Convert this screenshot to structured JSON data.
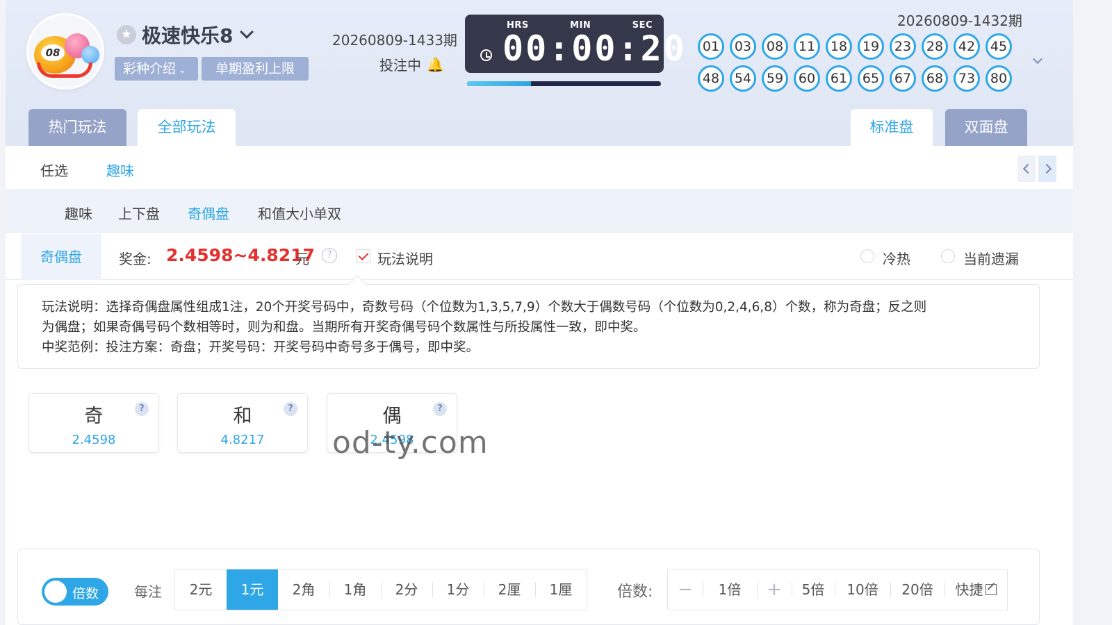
{
  "header": {
    "game_name": "极速快乐8",
    "logo_ball_number": "08",
    "tags": [
      "彩种介绍",
      "单期盈利上限"
    ],
    "current_issue": "20260809-1433期",
    "status": "投注中",
    "timer": {
      "labels": [
        "HRS",
        "MIN",
        "SEC"
      ],
      "display": "00:00:20",
      "progress": 0.33
    },
    "last_issue": "20260809-1432期",
    "draw_numbers": [
      "01",
      "03",
      "08",
      "11",
      "18",
      "19",
      "23",
      "28",
      "42",
      "45",
      "48",
      "54",
      "59",
      "60",
      "61",
      "65",
      "67",
      "68",
      "73",
      "80"
    ]
  },
  "main_tabs": {
    "left": [
      "热门玩法",
      "全部玩法"
    ],
    "right": [
      "标准盘",
      "双面盘"
    ],
    "active_left": "全部玩法",
    "active_right": "标准盘"
  },
  "sub_tabs": [
    "任选",
    "趣味"
  ],
  "sub_tabs_active": "趣味",
  "play_types": [
    "趣味",
    "上下盘",
    "奇偶盘",
    "和值大小单双"
  ],
  "play_types_active": "奇偶盘",
  "bet_info": {
    "play_tag": "奇偶盘",
    "prize_label": "奖金:",
    "prize_value": "2.4598~4.8217",
    "prize_unit": "元",
    "help_mark": "?",
    "rules_checkbox_label": "玩法说明",
    "radio_options": [
      "冷热",
      "当前遗漏"
    ]
  },
  "description": {
    "line1": "玩法说明：选择奇偶盘属性组成1注，20个开奖号码中，奇数号码（个位数为1,3,5,7,9）个数大于偶数号码（个位数为0,2,4,6,8）个数，称为奇盘；反之则",
    "line2": "为偶盘；如果奇偶号码个数相等时，则为和盘。当期所有开奖奇偶号码个数属性与所投属性一致，即中奖。",
    "line3": "中奖范例：投注方案：奇盘；开奖号码：开奖号码中奇号多于偶号，即中奖。"
  },
  "options": [
    {
      "name": "奇",
      "odds": "2.4598"
    },
    {
      "name": "和",
      "odds": "4.8217"
    },
    {
      "name": "偶",
      "odds": "2.4598"
    }
  ],
  "watermark": "od-ty.com",
  "bottom": {
    "toggle_label": "倍数",
    "per_bet_label": "每注",
    "units": [
      "2元",
      "1元",
      "2角",
      "1角",
      "2分",
      "1分",
      "2厘",
      "1厘"
    ],
    "selected_unit": "1元",
    "multiplier_label": "倍数:",
    "minus": "−",
    "plus": "+",
    "multiplier_value": "1倍",
    "quick_multipliers": [
      "5倍",
      "10倍",
      "20倍"
    ],
    "shortcut_label": "快捷"
  },
  "colors": {
    "accent": "#2fa6e6",
    "prize": "#e5302d",
    "header_bg": "#e3e9f6",
    "tag_bg": "#9fb0d6",
    "timer_bg": "#34384a"
  }
}
